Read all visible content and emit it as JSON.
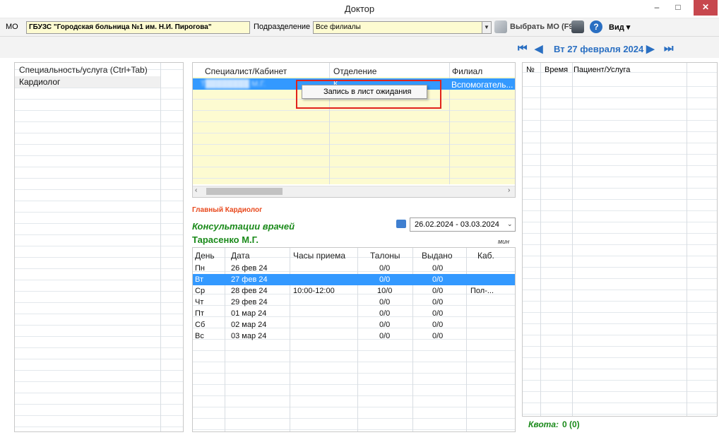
{
  "window": {
    "title": "Доктор",
    "minimize": "–",
    "maximize": "□",
    "close": "✕"
  },
  "toolbar": {
    "mo_label": "МО",
    "mo_value": "ГБУЗС \"Городская больница №1 им. Н.И. Пирогова\"",
    "division_label": "Подразделение",
    "division_value": "Все филиалы",
    "select_mo_label": "Выбрать МО (F9)",
    "view_label": "Вид ▾"
  },
  "nav": {
    "first": "⏮",
    "prev": "◀",
    "date": "Вт 27 февраля 2024",
    "next": "▶",
    "last": "⏭"
  },
  "specialties": {
    "header": "Специальность/услуга (Ctrl+Tab)",
    "items": [
      "Кардиолог"
    ]
  },
  "specialists": {
    "headers": [
      "Специалист/Кабинет",
      "Отделение",
      "Филиал"
    ],
    "row": {
      "name": "Т████████ М.Г.",
      "department": "К...",
      "branch": "Вспомогатель..."
    }
  },
  "context_menu": {
    "item": "Запись в лист ожидания"
  },
  "doctor": {
    "role": "Главный Кардиолог",
    "service": "Консультации врачей",
    "name": "Тарасенко М.Г.",
    "unit": "мин",
    "period": "26.02.2024 - 03.03.2024"
  },
  "schedule": {
    "headers": [
      "День",
      "Дата",
      "Часы приема",
      "Талоны",
      "Выдано",
      "Каб."
    ],
    "rows": [
      [
        "Пн",
        "26 фев 24",
        "",
        "0/0",
        "0/0",
        ""
      ],
      [
        "Вт",
        "27 фев 24",
        "",
        "0/0",
        "0/0",
        ""
      ],
      [
        "Ср",
        "28 фев 24",
        "10:00-12:00",
        "10/0",
        "0/0",
        "Пол-..."
      ],
      [
        "Чт",
        "29 фев 24",
        "",
        "0/0",
        "0/0",
        ""
      ],
      [
        "Пт",
        "01 мар 24",
        "",
        "0/0",
        "0/0",
        ""
      ],
      [
        "Сб",
        "02 мар 24",
        "",
        "0/0",
        "0/0",
        ""
      ],
      [
        "Вс",
        "03 мар 24",
        "",
        "0/0",
        "0/0",
        ""
      ]
    ]
  },
  "appointments": {
    "headers": [
      "№",
      "Время",
      "Пациент/Услуга"
    ]
  },
  "quota": {
    "label": "Квота:",
    "value": "0 (0)"
  },
  "colors": {
    "accent_blue": "#2a6fc2",
    "selected_row": "#3399ff",
    "yellow_field": "#fdfbd1",
    "role_red": "#e8481c",
    "service_green": "#1a8a1a",
    "highlight_red": "#e2231a"
  }
}
